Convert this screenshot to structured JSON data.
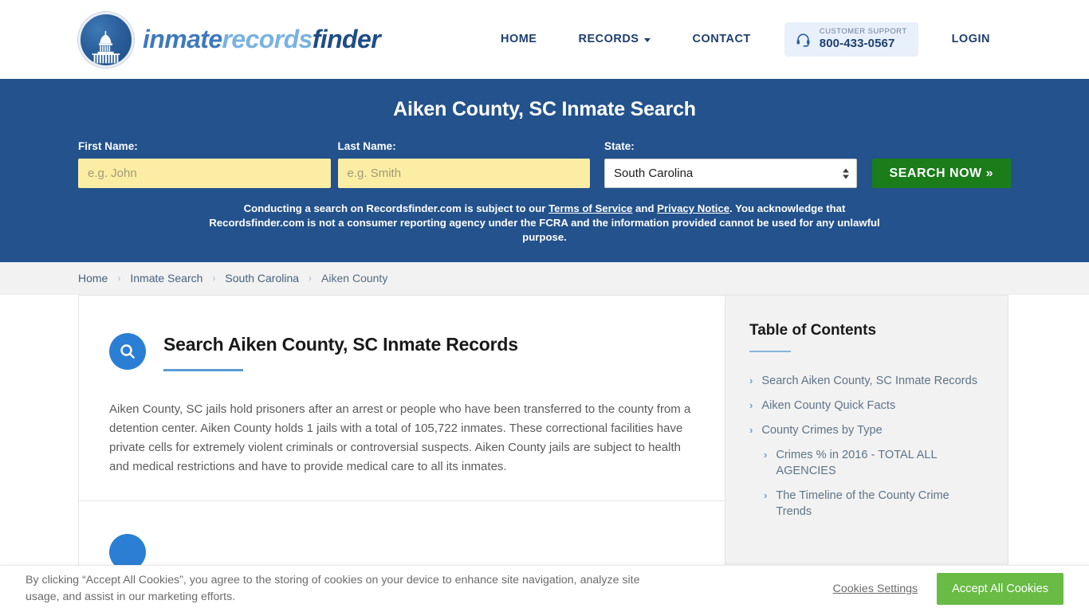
{
  "header": {
    "brand": {
      "part1": "inmate",
      "part2": "records",
      "part3": "finder",
      "seal_icon": "capitol-dome-icon"
    },
    "nav": [
      {
        "label": "HOME",
        "name": "nav-home"
      },
      {
        "label": "RECORDS",
        "name": "nav-records",
        "has_caret": true
      },
      {
        "label": "CONTACT",
        "name": "nav-contact"
      }
    ],
    "support": {
      "icon": "headset-icon",
      "label": "CUSTOMER SUPPORT",
      "phone": "800-433-0567",
      "pill_color": "#e8f0fb"
    },
    "login_label": "LOGIN"
  },
  "hero": {
    "background": "#23528c",
    "title": "Aiken County, SC Inmate Search",
    "first_name_label": "First Name:",
    "first_name_value": "",
    "first_name_placeholder": "e.g. John",
    "last_name_label": "Last Name:",
    "last_name_value": "",
    "last_name_placeholder": "e.g. Smith",
    "state_label": "State:",
    "state_value": "South Carolina",
    "state_options": [
      "South Carolina"
    ],
    "search_button": "SEARCH NOW »",
    "search_button_color": "#1a7d1a",
    "input_color": "#fbeea4",
    "disclaimer": {
      "part1": "Conducting a search on Recordsfinder.com is subject to our ",
      "link1": "Terms of Service",
      "part2": " and ",
      "link2": "Privacy Notice",
      "part3": ". You acknowledge that Recordsfinder.com is not a consumer reporting agency under the FCRA and the information provided cannot be used for any unlawful purpose."
    }
  },
  "breadcrumb": {
    "separator": "›",
    "items": [
      {
        "label": "Home",
        "name": "breadcrumb-home"
      },
      {
        "label": "Inmate Search",
        "name": "breadcrumb-inmate-search"
      },
      {
        "label": "South Carolina",
        "name": "breadcrumb-south-carolina"
      },
      {
        "label": "Aiken County",
        "name": "breadcrumb-aiken-county"
      }
    ]
  },
  "main": {
    "section1": {
      "icon": "magnifier-icon",
      "title": "Search Aiken County, SC Inmate Records",
      "paragraph": "Aiken County, SC jails hold prisoners after an arrest or people who have been transferred to the county from a detention center. Aiken County holds 1 jails with a total of 105,722 inmates. These correctional facilities have private cells for extremely violent criminals or controversial suspects. Aiken County jails are subject to health and medical restrictions and have to provide medical care to all its inmates."
    },
    "section2": {
      "icon": "info-circle-icon"
    }
  },
  "toc": {
    "title": "Table of Contents",
    "chevron": "›",
    "items": [
      {
        "label": "Search Aiken County, SC Inmate Records",
        "sub": false
      },
      {
        "label": "Aiken County Quick Facts",
        "sub": false
      },
      {
        "label": "County Crimes by Type",
        "sub": false
      },
      {
        "label": "Crimes % in 2016 - TOTAL ALL AGENCIES",
        "sub": true
      },
      {
        "label": "The Timeline of the County Crime Trends",
        "sub": true
      }
    ]
  },
  "cookie_banner": {
    "text": "By clicking “Accept All Cookies”, you agree to the storing of cookies on your device to enhance site navigation, analyze site usage, and assist in our marketing efforts.",
    "settings_label": "Cookies Settings",
    "accept_label": "Accept All Cookies",
    "accept_color": "#68bb45"
  }
}
